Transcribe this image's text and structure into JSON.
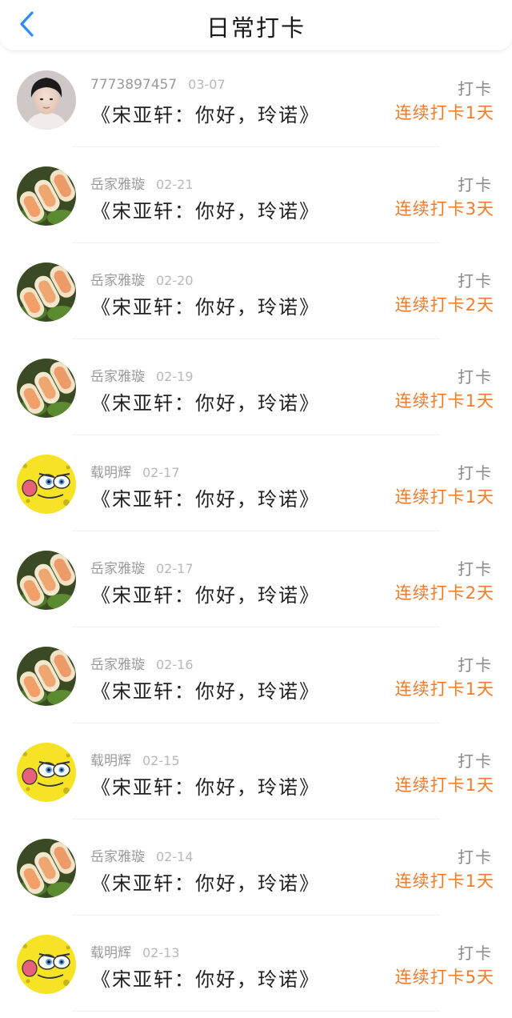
{
  "header": {
    "title": "日常打卡",
    "back_icon": "chevron-left-icon",
    "accent_color": "#2d8cf0"
  },
  "colors": {
    "streak": "#f07a2c",
    "action": "#8a8a8a",
    "username": "#9a9a9a"
  },
  "entries": [
    {
      "user": "7773897457",
      "date": "03-07",
      "text": "《宋亚轩：你好，玲诺》",
      "action": "打卡",
      "streak": "连续打卡1天",
      "avatar": "person-photo"
    },
    {
      "user": "岳家雅璇",
      "date": "02-21",
      "text": "《宋亚轩：你好，玲诺》",
      "action": "打卡",
      "streak": "连续打卡3天",
      "avatar": "spring-rolls-photo"
    },
    {
      "user": "岳家雅璇",
      "date": "02-20",
      "text": "《宋亚轩：你好，玲诺》",
      "action": "打卡",
      "streak": "连续打卡2天",
      "avatar": "spring-rolls-photo"
    },
    {
      "user": "岳家雅璇",
      "date": "02-19",
      "text": "《宋亚轩：你好，玲诺》",
      "action": "打卡",
      "streak": "连续打卡1天",
      "avatar": "spring-rolls-photo"
    },
    {
      "user": "载明辉",
      "date": "02-17",
      "text": "《宋亚轩：你好，玲诺》",
      "action": "打卡",
      "streak": "连续打卡1天",
      "avatar": "sponge-cartoon"
    },
    {
      "user": "岳家雅璇",
      "date": "02-17",
      "text": "《宋亚轩：你好，玲诺》",
      "action": "打卡",
      "streak": "连续打卡2天",
      "avatar": "spring-rolls-photo"
    },
    {
      "user": "岳家雅璇",
      "date": "02-16",
      "text": "《宋亚轩：你好，玲诺》",
      "action": "打卡",
      "streak": "连续打卡1天",
      "avatar": "spring-rolls-photo"
    },
    {
      "user": "载明辉",
      "date": "02-15",
      "text": "《宋亚轩：你好，玲诺》",
      "action": "打卡",
      "streak": "连续打卡1天",
      "avatar": "sponge-cartoon"
    },
    {
      "user": "岳家雅璇",
      "date": "02-14",
      "text": "《宋亚轩：你好，玲诺》",
      "action": "打卡",
      "streak": "连续打卡1天",
      "avatar": "spring-rolls-photo"
    },
    {
      "user": "载明辉",
      "date": "02-13",
      "text": "《宋亚轩：你好，玲诺》",
      "action": "打卡",
      "streak": "连续打卡5天",
      "avatar": "sponge-cartoon"
    }
  ]
}
